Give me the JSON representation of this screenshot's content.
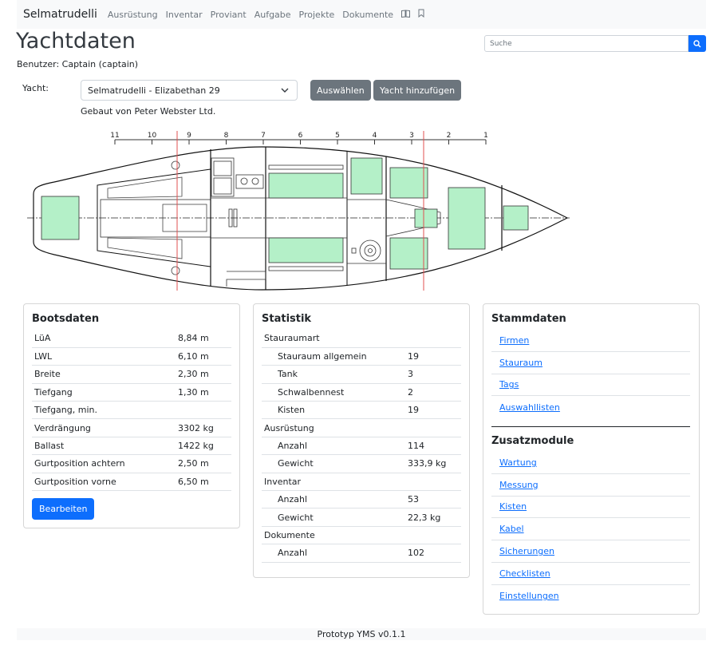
{
  "navbar": {
    "brand": "Selmatrudelli",
    "links": [
      "Ausrüstung",
      "Inventar",
      "Proviant",
      "Aufgabe",
      "Projekte",
      "Dokumente"
    ],
    "icons": [
      "book-icon",
      "bookmark-icon"
    ]
  },
  "page": {
    "title": "Yachtdaten",
    "user_line": "Benutzer: Captain (captain)"
  },
  "search": {
    "placeholder": "Suche",
    "icon": "search-icon"
  },
  "yacht": {
    "label": "Yacht:",
    "selected": "Selmatrudelli - Elizabethan 29",
    "select_button": "Auswählen",
    "add_button": "Yacht hinzufügen",
    "built_by": "Gebaut von Peter Webster Ltd."
  },
  "plan": {
    "ruler": [
      "11",
      "10",
      "9",
      "8",
      "7",
      "6",
      "5",
      "4",
      "3",
      "2",
      "1"
    ],
    "colors": {
      "storage": "#b4f0c8",
      "marker": "#e05050"
    }
  },
  "boat_card": {
    "title": "Bootsdaten",
    "rows": [
      {
        "label": "LüA",
        "value": "8,84 m"
      },
      {
        "label": "LWL",
        "value": "6,10 m"
      },
      {
        "label": "Breite",
        "value": "2,30 m"
      },
      {
        "label": "Tiefgang",
        "value": "1,30 m"
      },
      {
        "label": "Tiefgang, min.",
        "value": ""
      },
      {
        "label": "Verdrängung",
        "value": "3302 kg"
      },
      {
        "label": "Ballast",
        "value": "1422 kg"
      },
      {
        "label": "Gurtposition achtern",
        "value": "2,50 m"
      },
      {
        "label": "Gurtposition vorne",
        "value": "6,50 m"
      }
    ],
    "edit_button": "Bearbeiten"
  },
  "stats_card": {
    "title": "Statistik",
    "rows": [
      {
        "label": "Stauraumart",
        "value": "",
        "indent": false
      },
      {
        "label": "Stauraum allgemein",
        "value": "19",
        "indent": true
      },
      {
        "label": "Tank",
        "value": "3",
        "indent": true
      },
      {
        "label": "Schwalbennest",
        "value": "2",
        "indent": true
      },
      {
        "label": "Kisten",
        "value": "19",
        "indent": true
      },
      {
        "label": "Ausrüstung",
        "value": "",
        "indent": false
      },
      {
        "label": "Anzahl",
        "value": "114",
        "indent": true
      },
      {
        "label": "Gewicht",
        "value": "333,9 kg",
        "indent": true
      },
      {
        "label": "Inventar",
        "value": "",
        "indent": false
      },
      {
        "label": "Anzahl",
        "value": "53",
        "indent": true
      },
      {
        "label": "Gewicht",
        "value": "22,3 kg",
        "indent": true
      },
      {
        "label": "Dokumente",
        "value": "",
        "indent": false
      },
      {
        "label": "Anzahl",
        "value": "102",
        "indent": true
      }
    ]
  },
  "master_card": {
    "title": "Stammdaten",
    "links": [
      "Firmen",
      "Stauraum",
      "Tags",
      "Auswahllisten"
    ],
    "modules_title": "Zusatzmodule",
    "modules": [
      "Wartung",
      "Messung",
      "Kisten",
      "Kabel",
      "Sicherungen",
      "Checklisten",
      "Einstellungen"
    ]
  },
  "footer": {
    "text": "Prototyp YMS v0.1.1"
  }
}
